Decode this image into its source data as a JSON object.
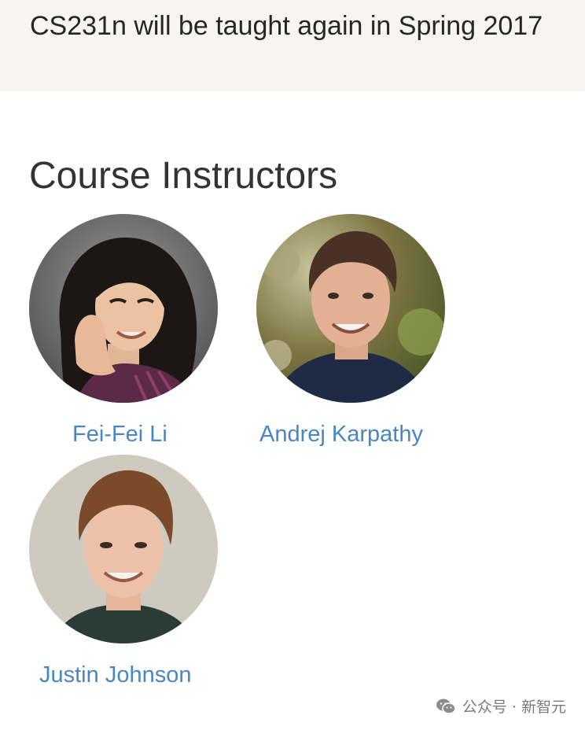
{
  "announcement": {
    "text": "CS231n will be taught again in Spring 2017",
    "background": "#f6f5f2"
  },
  "section": {
    "title": "Course Instructors"
  },
  "instructors": [
    {
      "name": "Fei-Fei Li",
      "photo_icon": "portrait-photo-fei-fei-li"
    },
    {
      "name": "Andrej Karpathy",
      "photo_icon": "portrait-photo-andrej-karpathy"
    },
    {
      "name": "Justin Johnson",
      "photo_icon": "portrait-photo-justin-johnson"
    }
  ],
  "colors": {
    "link": "#4a87c2",
    "title": "#333333",
    "text": "#262626"
  },
  "watermark": {
    "icon": "wechat-icon",
    "text": "公众号 · 新智元"
  }
}
